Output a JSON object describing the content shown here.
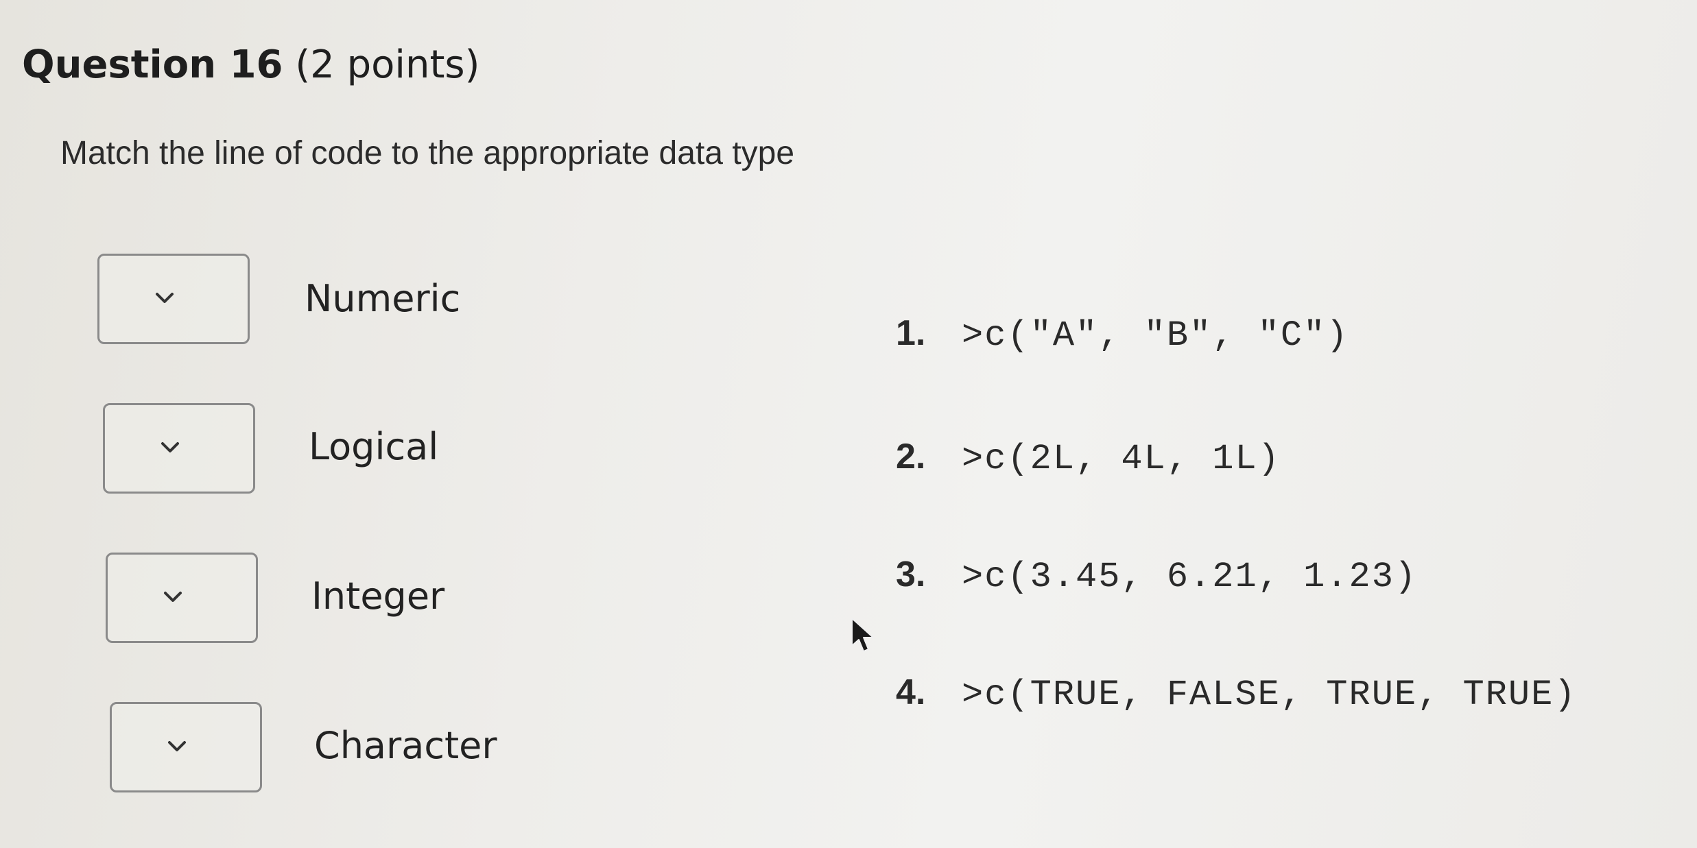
{
  "question": {
    "title": "Question 16",
    "points": "(2 points)",
    "prompt": "Match the line of code to the appropriate data type"
  },
  "terms": [
    {
      "label": "Numeric",
      "selected": ""
    },
    {
      "label": "Logical",
      "selected": ""
    },
    {
      "label": "Integer",
      "selected": ""
    },
    {
      "label": "Character",
      "selected": ""
    }
  ],
  "options": [
    {
      "number": "1.",
      "code": ">c(\"A\", \"B\", \"C\")"
    },
    {
      "number": "2.",
      "code": ">c(2L, 4L, 1L)"
    },
    {
      "number": "3.",
      "code": ">c(3.45, 6.21, 1.23)"
    },
    {
      "number": "4.",
      "code": ">c(TRUE, FALSE, TRUE, TRUE)"
    }
  ],
  "icons": {
    "dropdown": "chevron-down-icon",
    "cursor": "mouse-pointer-icon"
  },
  "colors": {
    "text": "#2a2a2a",
    "select_border": "#8a8a8a",
    "background": "#eeedea"
  }
}
